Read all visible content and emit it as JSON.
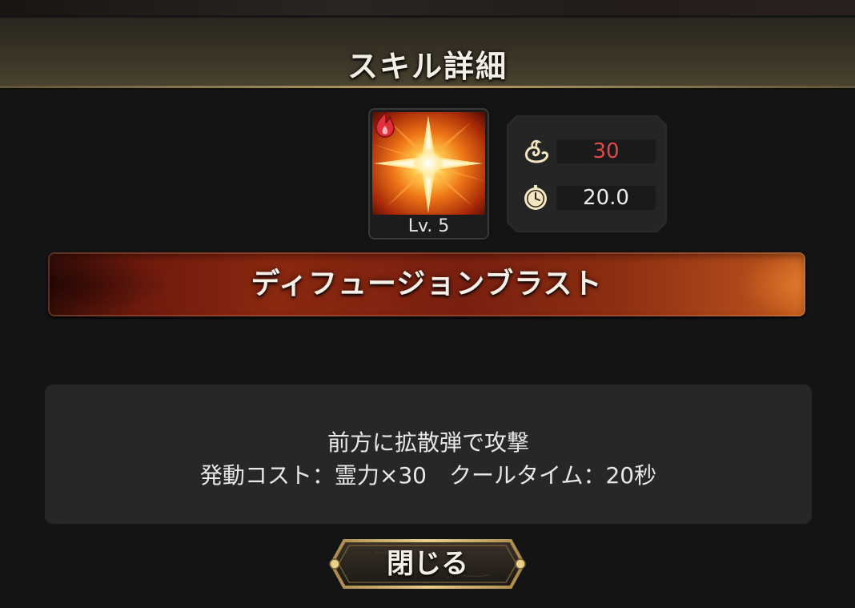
{
  "dialog": {
    "title": "スキル詳細"
  },
  "skill": {
    "icon": "burst-star-icon",
    "element_icon": "fire-icon",
    "level": "Lv. 5",
    "name": "ディフュージョンブラスト"
  },
  "stats": {
    "cost_icon": "spirit-icon",
    "cost": "30",
    "cost_color": "#e04a4a",
    "cooldown_icon": "stopwatch-icon",
    "cooldown": "20.0"
  },
  "description": {
    "line1": "前方に拡散弾で攻撃",
    "line2": "発動コスト：霊力×30　クールタイム：20秒"
  },
  "buttons": {
    "close": "閉じる"
  },
  "colors": {
    "header_gold": "#b8a06a",
    "banner_red": "#8a2810"
  }
}
